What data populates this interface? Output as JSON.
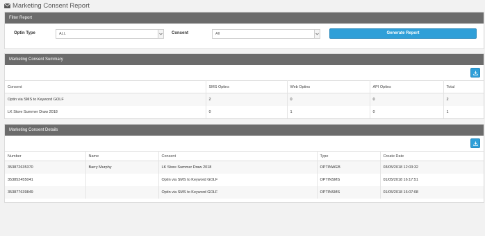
{
  "page": {
    "title": "Marketing Consent Report",
    "icon": "envelope-icon"
  },
  "filter": {
    "heading": "Filter Report",
    "optin_type_label": "Optin Type",
    "optin_type_value": "ALL",
    "consent_label": "Consent",
    "consent_value": "All",
    "generate_label": "Generate Report"
  },
  "summary": {
    "heading": "Marketing Consent Summary",
    "download_icon": "download-icon",
    "columns": [
      "Consent",
      "SMS Optins",
      "Web Optins",
      "API Optins",
      "Total"
    ],
    "rows": [
      [
        "Optin via SMS to Keyword GOLF",
        "2",
        "0",
        "0",
        "2"
      ],
      [
        "LK Store Summer Draw 2018",
        "0",
        "1",
        "0",
        "1"
      ]
    ]
  },
  "details": {
    "heading": "Marketing Consent Details",
    "download_icon": "download-icon",
    "columns": [
      "Number",
      "Name",
      "Consent",
      "Type",
      "Create Date"
    ],
    "rows": [
      [
        "353872635370",
        "Barry Murphy",
        "LK Store Summer Draw 2018",
        "OPTINWEB",
        "03/05/2018 12:03:32"
      ],
      [
        "353852455041",
        "",
        "Optin via SMS to Keyword GOLF",
        "OPTINSMS",
        "01/05/2018 16:17:51"
      ],
      [
        "353877639849",
        "",
        "Optin via SMS to Keyword GOLF",
        "OPTINSMS",
        "01/05/2018 16:07:08"
      ]
    ]
  },
  "colors": {
    "panel_header": "#6b6b6b",
    "accent": "#2f9fd8"
  }
}
